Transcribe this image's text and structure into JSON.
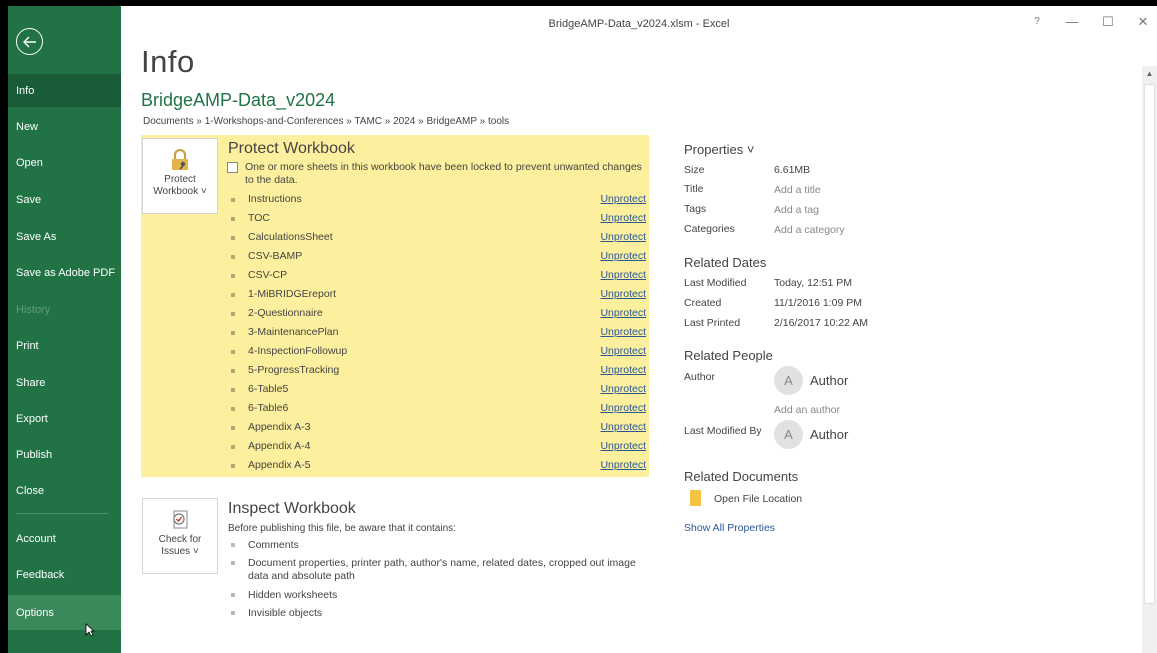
{
  "window": {
    "title": "BridgeAMP-Data_v2024.xlsm  -  Excel",
    "help": "?",
    "minimize": "—",
    "maximize": "☐",
    "close": "✕"
  },
  "sidebar": {
    "items": [
      {
        "label": "Info"
      },
      {
        "label": "New"
      },
      {
        "label": "Open"
      },
      {
        "label": "Save"
      },
      {
        "label": "Save As"
      },
      {
        "label": "Save as Adobe PDF"
      },
      {
        "label": "History"
      },
      {
        "label": "Print"
      },
      {
        "label": "Share"
      },
      {
        "label": "Export"
      },
      {
        "label": "Publish"
      },
      {
        "label": "Close"
      },
      {
        "label": "Account"
      },
      {
        "label": "Feedback"
      },
      {
        "label": "Options"
      }
    ]
  },
  "main": {
    "page_title": "Info",
    "doc_name": "BridgeAMP-Data_v2024",
    "breadcrumb": "Documents » 1-Workshops-and-Conferences » TAMC » 2024 » BridgeAMP » tools",
    "protect": {
      "button_line1": "Protect",
      "button_line2": "Workbook ˅",
      "title": "Protect Workbook",
      "description": "One or more sheets in this workbook have been locked to prevent unwanted changes to the data.",
      "unprotect_label": "Unprotect",
      "sheets": [
        {
          "name": "Instructions"
        },
        {
          "name": "TOC"
        },
        {
          "name": "CalculationsSheet"
        },
        {
          "name": "CSV-BAMP"
        },
        {
          "name": "CSV-CP"
        },
        {
          "name": "1-MiBRIDGEreport"
        },
        {
          "name": "2-Questionnaire"
        },
        {
          "name": "3-MaintenancePlan"
        },
        {
          "name": "4-InspectionFollowup"
        },
        {
          "name": "5-ProgressTracking"
        },
        {
          "name": "6-Table5"
        },
        {
          "name": "6-Table6"
        },
        {
          "name": "Appendix A-3"
        },
        {
          "name": "Appendix A-4"
        },
        {
          "name": "Appendix A-5"
        }
      ]
    },
    "inspect": {
      "button_line1": "Check for",
      "button_line2": "Issues ˅",
      "title": "Inspect Workbook",
      "description": "Before publishing this file, be aware that it contains:",
      "items": [
        {
          "text": "Comments"
        },
        {
          "text": "Document properties, printer path, author's name, related dates, cropped out image data and absolute path"
        },
        {
          "text": "Hidden worksheets"
        },
        {
          "text": "Invisible objects"
        }
      ]
    }
  },
  "properties": {
    "heading": "Properties ˅",
    "size_label": "Size",
    "size_value": "6.61MB",
    "title_label": "Title",
    "title_value": "Add a title",
    "tags_label": "Tags",
    "tags_value": "Add a tag",
    "categories_label": "Categories",
    "categories_value": "Add a category",
    "dates_heading": "Related Dates",
    "last_modified_label": "Last Modified",
    "last_modified_value": "Today, 12:51 PM",
    "created_label": "Created",
    "created_value": "11/1/2016 1:09 PM",
    "last_printed_label": "Last Printed",
    "last_printed_value": "2/16/2017 10:22 AM",
    "people_heading": "Related People",
    "author_label": "Author",
    "author_initial": "A",
    "author_name": "Author",
    "add_author": "Add an author",
    "last_modified_by_label": "Last Modified By",
    "last_modified_by_initial": "A",
    "last_modified_by_name": "Author",
    "docs_heading": "Related Documents",
    "open_file_location": "Open File Location",
    "show_all": "Show All Properties"
  },
  "colors": {
    "sidebar": "#217346",
    "sidebar_active": "#1a5c38",
    "protect_panel": "#fcef9d",
    "link": "#2b5797"
  }
}
